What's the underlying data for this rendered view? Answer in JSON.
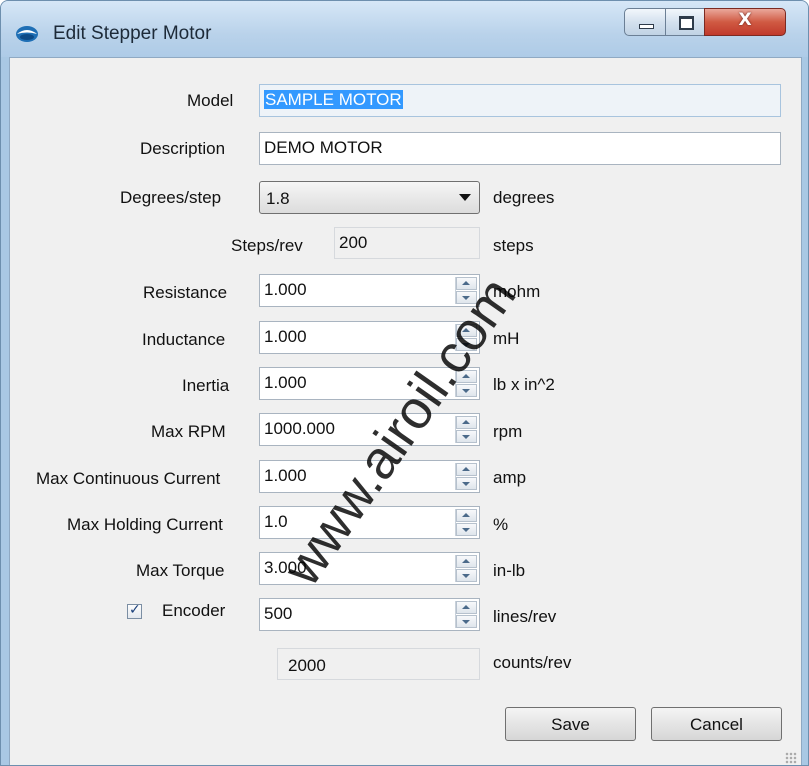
{
  "window": {
    "title": "Edit Stepper Motor",
    "close_glyph": "X",
    "icon": "app-icon"
  },
  "model": {
    "label": "Model",
    "value": "SAMPLE MOTOR"
  },
  "description": {
    "label": "Description",
    "value": "DEMO MOTOR"
  },
  "degrees_step": {
    "label": "Degrees/step",
    "value": "1.8",
    "unit": "degrees"
  },
  "steps_rev": {
    "label": "Steps/rev",
    "value": "200",
    "unit": "steps"
  },
  "resistance": {
    "label": "Resistance",
    "value": "1.000",
    "unit": "mohm"
  },
  "inductance": {
    "label": "Inductance",
    "value": "1.000",
    "unit": "mH"
  },
  "inertia": {
    "label": "Inertia",
    "value": "1.000",
    "unit": "lb x in^2"
  },
  "max_rpm": {
    "label": "Max RPM",
    "value": "1000.000",
    "unit": "rpm"
  },
  "max_continuous_current": {
    "label": "Max Continuous Current",
    "value": "1.000",
    "unit": "amp"
  },
  "max_holding_current": {
    "label": "Max Holding Current",
    "value": "1.0",
    "unit": "%"
  },
  "max_torque": {
    "label": "Max Torque",
    "value": "3.000",
    "unit": "in-lb"
  },
  "encoder": {
    "label": "Encoder",
    "checked": true,
    "check_glyph": "✓",
    "value": "500",
    "unit": "lines/rev"
  },
  "counts": {
    "value": "2000",
    "unit": "counts/rev"
  },
  "buttons": {
    "save": "Save",
    "cancel": "Cancel"
  },
  "watermark": "www.airoil.com"
}
